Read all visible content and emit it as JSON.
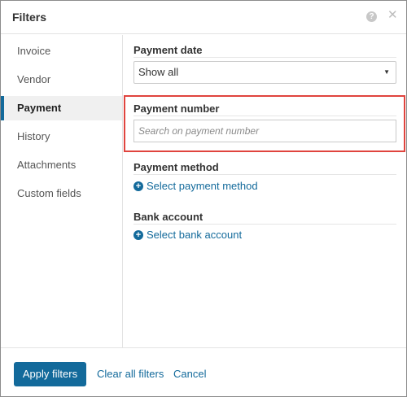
{
  "header": {
    "title": "Filters",
    "help_glyph": "?",
    "close_glyph": "✕"
  },
  "sidebar": {
    "items": [
      {
        "label": "Invoice"
      },
      {
        "label": "Vendor"
      },
      {
        "label": "Payment",
        "active": true
      },
      {
        "label": "History"
      },
      {
        "label": "Attachments"
      },
      {
        "label": "Custom fields"
      }
    ]
  },
  "content": {
    "payment_date": {
      "label": "Payment date",
      "selected": "Show all"
    },
    "payment_number": {
      "label": "Payment number",
      "value": "",
      "placeholder": "Search on payment number"
    },
    "payment_method": {
      "label": "Payment method",
      "link": "Select payment method"
    },
    "bank_account": {
      "label": "Bank account",
      "link": "Select bank account"
    }
  },
  "footer": {
    "apply_label": "Apply filters",
    "clear_label": "Clear all filters",
    "cancel_label": "Cancel"
  },
  "colors": {
    "accent": "#136a9b",
    "highlight": "#e0443e"
  }
}
